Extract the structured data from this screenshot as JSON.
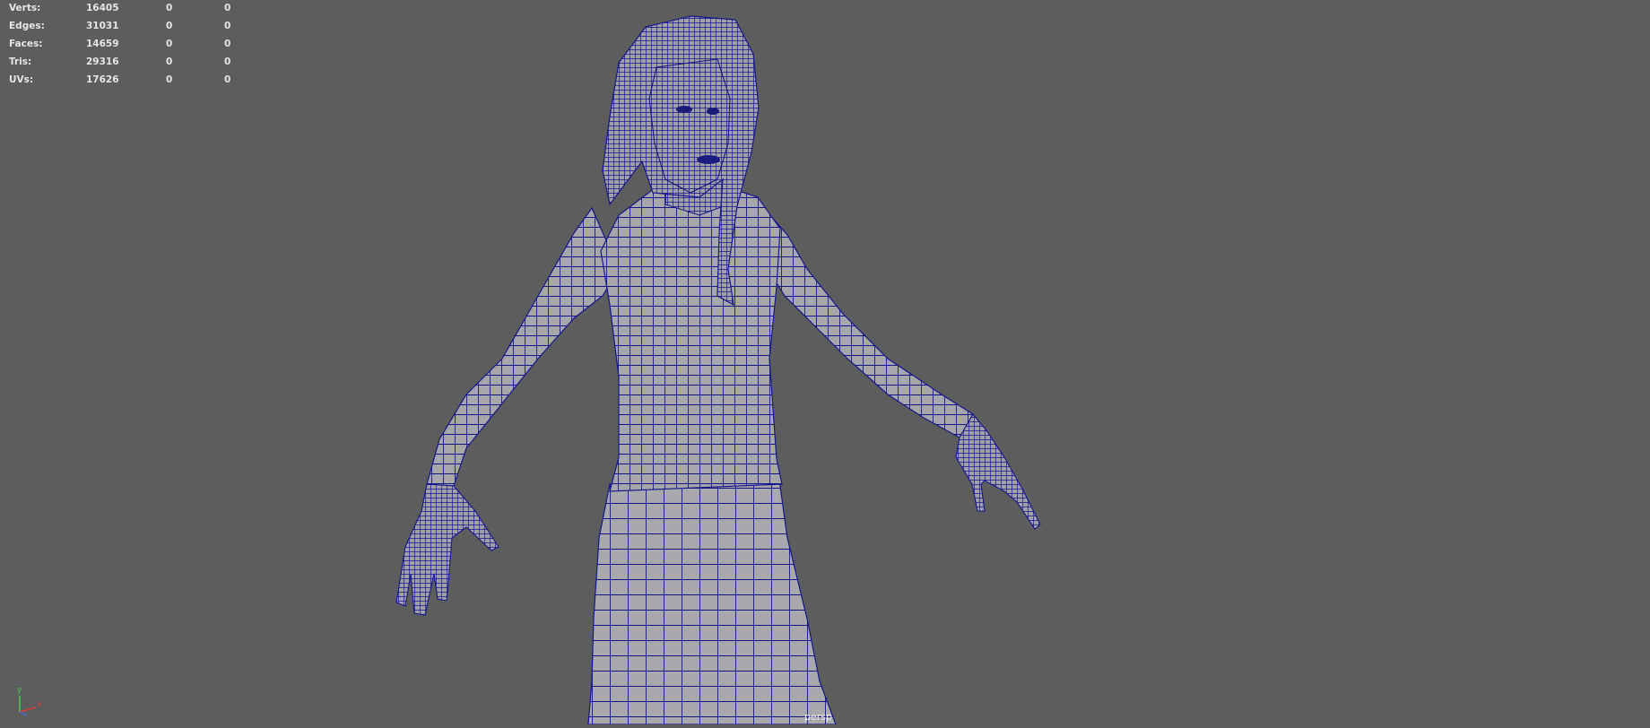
{
  "viewport": {
    "background": "#5d5d5d",
    "mesh_fill": "#a5a5a9",
    "wire_color": "#14148c",
    "camera": "persp"
  },
  "stats": [
    {
      "label": "Verts:",
      "total": "16405",
      "selected": "0",
      "component": "0"
    },
    {
      "label": "Edges:",
      "total": "31031",
      "selected": "0",
      "component": "0"
    },
    {
      "label": "Faces:",
      "total": "14659",
      "selected": "0",
      "component": "0"
    },
    {
      "label": "Tris:",
      "total": "29316",
      "selected": "0",
      "component": "0"
    },
    {
      "label": "UVs:",
      "total": "17626",
      "selected": "0",
      "component": "0"
    }
  ],
  "axis": {
    "y": "y",
    "x": "x",
    "y_color": "#4ec94e",
    "x_color": "#d23c3c",
    "z_color": "#4a6cd4"
  }
}
